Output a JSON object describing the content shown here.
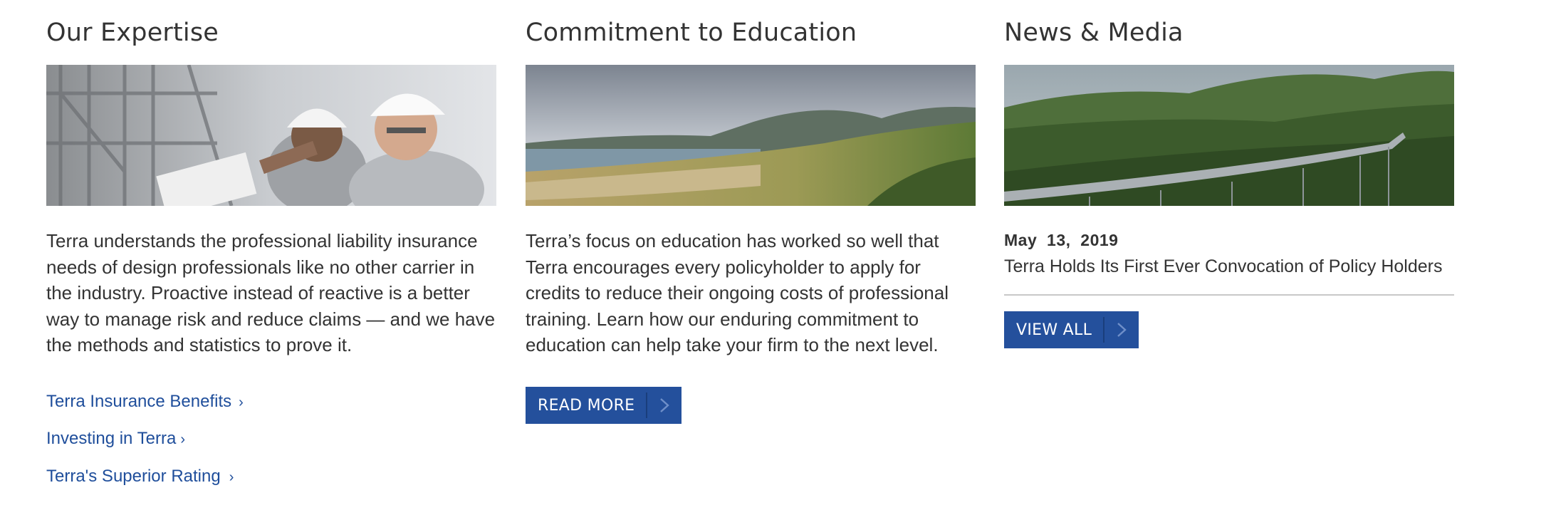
{
  "expertise": {
    "title": "Our Expertise",
    "body": "Terra understands the professional liability insurance needs of design professionals like no other carrier in the industry. Proactive instead of reactive is a better way to manage risk and reduce claims — and we have the methods and statistics to prove it.",
    "links": [
      {
        "label": "Terra Insurance Benefits",
        "chevron": "›"
      },
      {
        "label": "Investing in Terra",
        "chevron": "›"
      },
      {
        "label": "Terra's Superior Rating",
        "chevron": "›"
      }
    ]
  },
  "education": {
    "title": "Commitment to Education",
    "body": "Terra’s focus on education has worked so well that Terra encourages every policyholder to apply for credits to reduce their ongoing costs of professional training. Learn how our enduring commitment to education can help take your firm to the next level.",
    "button_label": "READ MORE"
  },
  "news": {
    "title": "News & Media",
    "date": "May  13,  2019",
    "headline": "Terra Holds Its First Ever Convocation of Policy Holders",
    "button_label": "VIEW ALL"
  },
  "icons": {
    "link_chevron": "chevron-right-icon",
    "button_arrow": "arrow-right-icon"
  },
  "colors": {
    "link": "#1f4e9b",
    "button": "#24509c",
    "text": "#333333"
  }
}
